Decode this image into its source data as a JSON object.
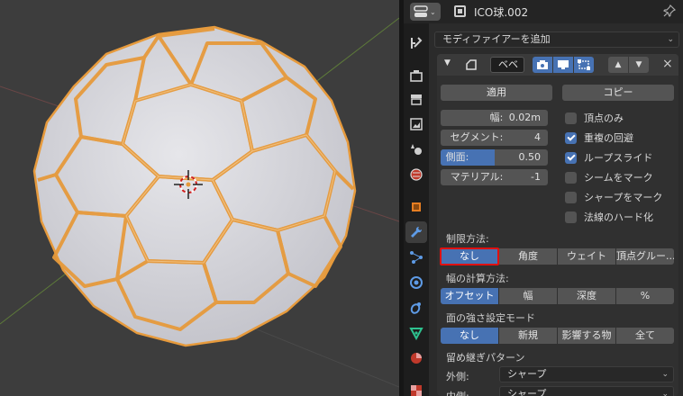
{
  "header": {
    "object_name": "ICO球.002",
    "editor_icon": "properties-editor-icon",
    "pin_icon": "pin-icon"
  },
  "add_modifier": {
    "label": "モディファイアーを追加"
  },
  "modifier": {
    "name": "ベベ",
    "apply_label": "適用",
    "copy_label": "コピー",
    "fields": [
      {
        "label": "幅:",
        "value": "0.02m"
      },
      {
        "label": "セグメント:",
        "value": "4"
      },
      {
        "label": "側面:",
        "value": "0.50",
        "fill": 0.5
      },
      {
        "label": "マテリアル:",
        "value": "-1"
      }
    ],
    "checkboxes": [
      {
        "label": "頂点のみ",
        "checked": false
      },
      {
        "label": "重複の回避",
        "checked": true
      },
      {
        "label": "ループスライド",
        "checked": true
      },
      {
        "label": "シームをマーク",
        "checked": false
      },
      {
        "label": "シャープをマーク",
        "checked": false
      },
      {
        "label": "法線のハード化",
        "checked": false
      }
    ],
    "limit_method": {
      "label": "制限方法:",
      "options": [
        "なし",
        "角度",
        "ウェイト",
        "頂点グルー..."
      ],
      "selected": 0
    },
    "width_method": {
      "label": "幅の計算方法:",
      "options": [
        "オフセット",
        "幅",
        "深度",
        "%"
      ],
      "selected": 0
    },
    "face_strength": {
      "label": "面の強さ設定モード",
      "options": [
        "なし",
        "新規",
        "影響する物",
        "全て"
      ],
      "selected": 0
    },
    "miter": {
      "label": "留め継ぎパターン",
      "outer_label": "外側:",
      "outer_value": "シャープ",
      "inner_label": "内側:",
      "inner_value": "シャープ"
    }
  },
  "colors": {
    "accent": "#4772b3",
    "selection": "#e69a3c",
    "highlight": "#e01010"
  }
}
